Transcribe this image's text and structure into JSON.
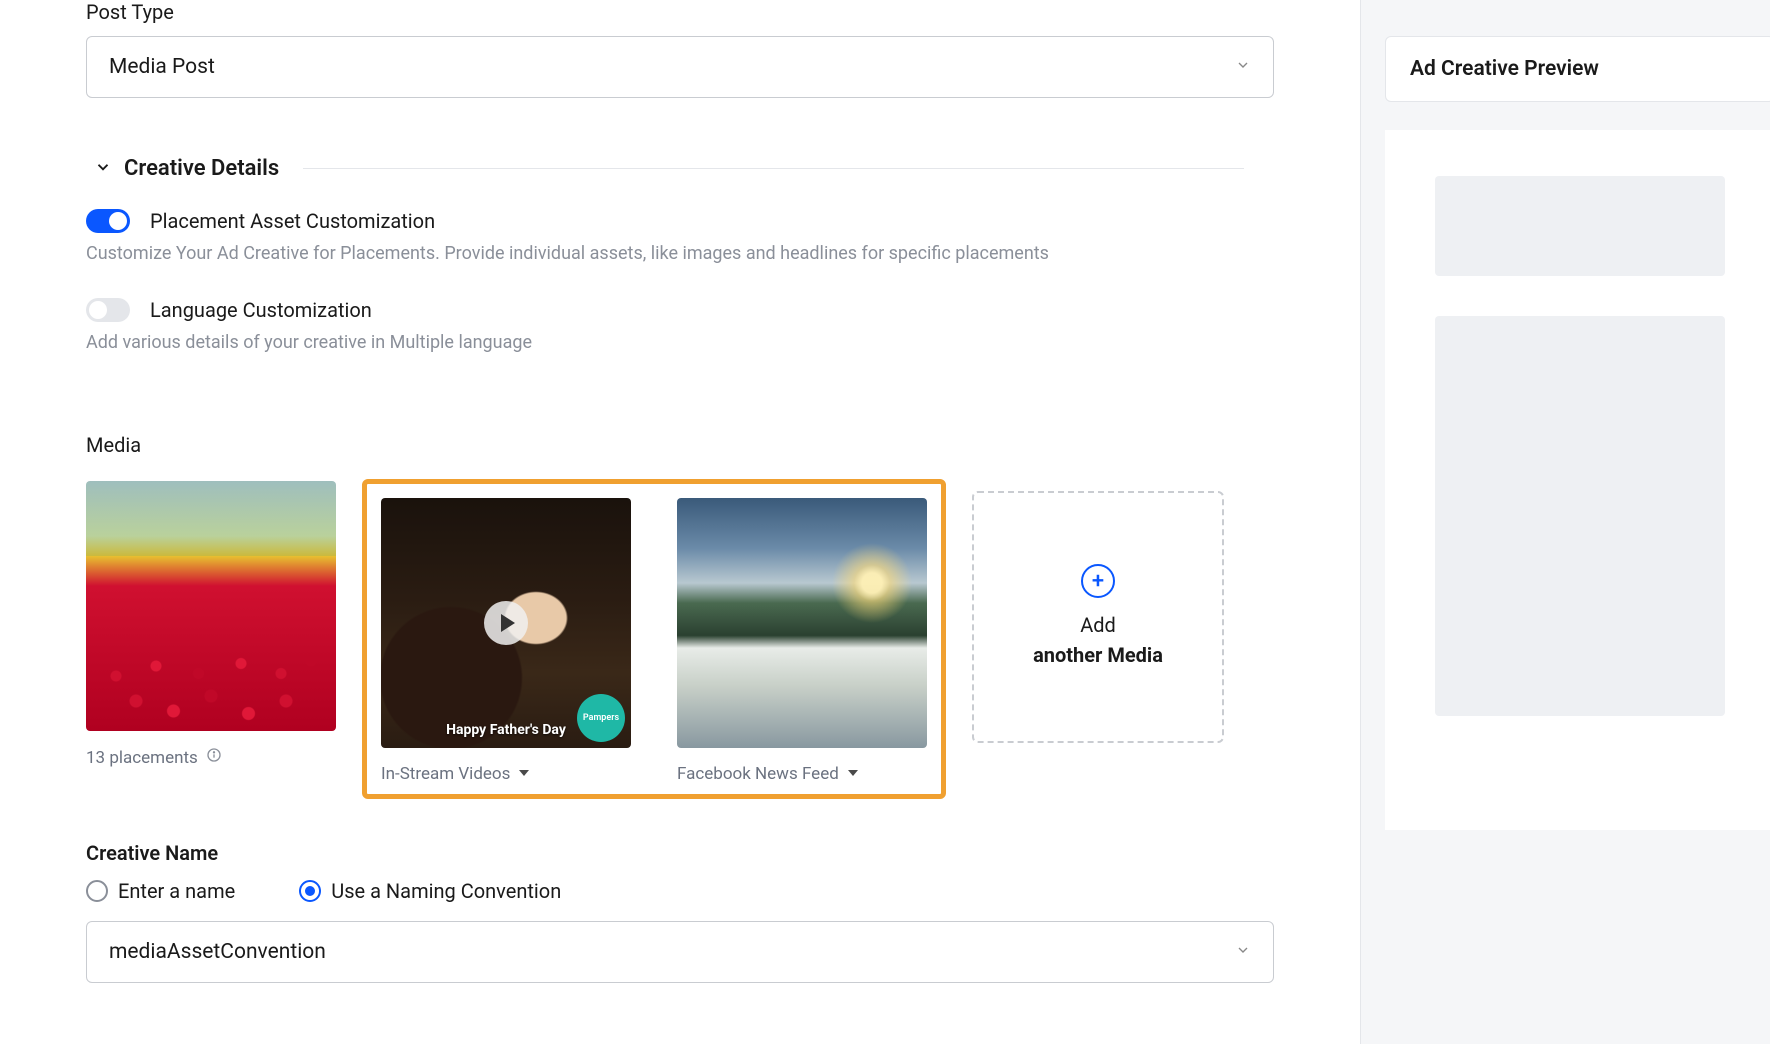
{
  "post_type": {
    "label": "Post Type",
    "value": "Media Post"
  },
  "creative_details": {
    "title": "Creative Details",
    "placement_asset": {
      "label": "Placement Asset Customization",
      "description": "Customize Your Ad Creative for Placements. Provide individual assets, like images and headlines for specific placements",
      "enabled": true
    },
    "language": {
      "label": "Language Customization",
      "description": "Add various details of your creative in Multiple language",
      "enabled": false
    }
  },
  "media": {
    "heading": "Media",
    "items": [
      {
        "label": "13 placements",
        "kind": "image-flowers",
        "has_info": true
      },
      {
        "label": "In-Stream Videos",
        "kind": "video",
        "caption": "Happy Father's Day",
        "badge": "Pampers",
        "has_dropdown": true
      },
      {
        "label": "Facebook News Feed",
        "kind": "image-landscape",
        "has_dropdown": true
      }
    ],
    "add": {
      "line1": "Add",
      "line2": "another Media"
    }
  },
  "creative_name": {
    "heading": "Creative Name",
    "options": [
      {
        "label": "Enter a name",
        "checked": false
      },
      {
        "label": "Use a Naming Convention",
        "checked": true
      }
    ],
    "convention_value": "mediaAssetConvention"
  },
  "preview": {
    "title": "Ad Creative Preview"
  }
}
